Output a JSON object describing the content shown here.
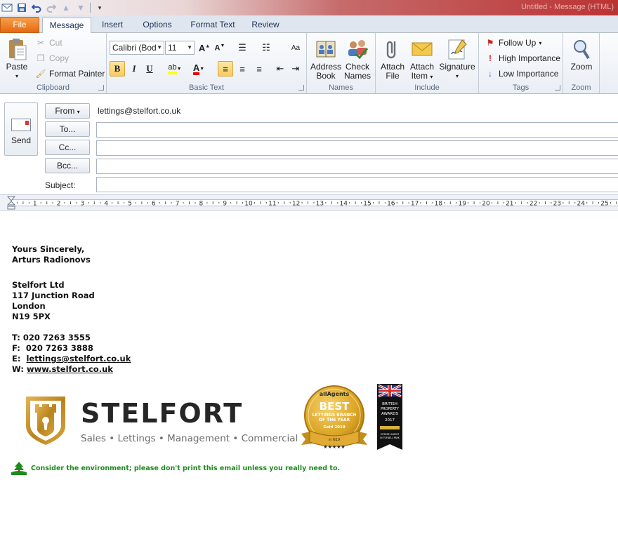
{
  "qat": {
    "save_icon": "save-icon",
    "undo_icon": "undo-icon",
    "redo_icon": "redo-icon"
  },
  "window": {
    "title": "Untitled - Message (HTML)"
  },
  "tabs": [
    {
      "label": "File"
    },
    {
      "label": "Message"
    },
    {
      "label": "Insert"
    },
    {
      "label": "Options"
    },
    {
      "label": "Format Text"
    },
    {
      "label": "Review"
    }
  ],
  "ribbon": {
    "clipboard": {
      "label": "Clipboard",
      "paste": "Paste",
      "cut": "Cut",
      "copy": "Copy",
      "format_painter": "Format Painter"
    },
    "basic_text": {
      "label": "Basic Text",
      "font": "Calibri (Body)",
      "size": "11",
      "bold": "B",
      "italic": "I",
      "underline": "U"
    },
    "names": {
      "label": "Names",
      "address_book": [
        "Address",
        "Book"
      ],
      "check_names": [
        "Check",
        "Names"
      ]
    },
    "include": {
      "label": "Include",
      "attach_file": [
        "Attach",
        "File"
      ],
      "attach_item": [
        "Attach",
        "Item"
      ],
      "signature": "Signature"
    },
    "tags": {
      "label": "Tags",
      "follow_up": "Follow Up",
      "high_importance": "High Importance",
      "low_importance": "Low Importance"
    },
    "zoom": {
      "label": "Zoom",
      "zoom": "Zoom"
    }
  },
  "header": {
    "send": "Send",
    "from_label": "From",
    "from_value": "lettings@stelfort.co.uk",
    "to_label": "To...",
    "cc_label": "Cc...",
    "bcc_label": "Bcc...",
    "subject_label": "Subject:",
    "to_value": "",
    "cc_value": "",
    "bcc_value": "",
    "subject_value": ""
  },
  "ruler": {
    "marks": [
      "1",
      "2",
      "3",
      "4",
      "5",
      "6",
      "7",
      "8",
      "9",
      "10",
      "11",
      "12",
      "13",
      "14",
      "15",
      "16",
      "17",
      "18",
      "19",
      "20",
      "21",
      "22",
      "23",
      "24",
      "25"
    ]
  },
  "signature": {
    "closing": "Yours Sincerely,",
    "name": "Arturs Radionovs",
    "company": "Stelfort Ltd",
    "street": "117 Junction Road",
    "city": "London",
    "postcode": "N19 5PX",
    "tel_label": "T:",
    "tel": "020 7263 3555",
    "fax_label": "F:",
    "fax": "020 7263 3888",
    "email_label": "E:",
    "email": "lettings@stelfort.co.uk",
    "web_label": "W:",
    "web": "www.stelfort.co.uk"
  },
  "logo": {
    "brand": "STELFORT",
    "tagline": "Sales • Lettings • Management • Commercial"
  },
  "award_best": {
    "source": "allAgents",
    "line1": "BEST",
    "line2": "LETTINGS BRANCH",
    "line3": "OF THE YEAR",
    "medal": "Gold 2019",
    "area": "in N19",
    "stars": "★★★★★"
  },
  "award_british": {
    "line1": "BRITISH",
    "line2": "PROPERTY",
    "line3": "AWARDS",
    "year": "2017",
    "footer1": "ESTATE AGENT",
    "footer2": "IN TUFNELL PARK"
  },
  "environment_note": "Consider the environment; please don't print this email unless you really need to.",
  "colors": {
    "file_tab": "#e46a12",
    "accent": "#1e3357",
    "env_green": "#1d8a1d",
    "gold": "#c8941f"
  }
}
